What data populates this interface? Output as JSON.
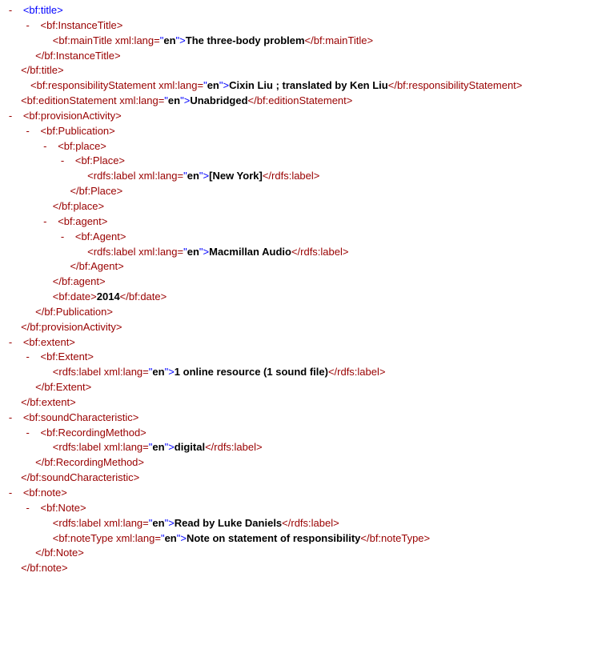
{
  "lang": "en",
  "toggle": "-",
  "tags": {
    "bf_title_open": "<bf:title>",
    "bf_title_close": "</bf:title>",
    "bf_InstanceTitle_open": "<bf:InstanceTitle>",
    "bf_InstanceTitle_close": "</bf:InstanceTitle>",
    "bf_mainTitle_open": "<bf:mainTitle",
    "bf_mainTitle_close": "</bf:mainTitle>",
    "bf_responsibility_open": "<bf:responsibilityStatement",
    "bf_responsibility_close": "</bf:responsibilityStatement>",
    "bf_edition_open": "<bf:editionStatement",
    "bf_edition_close": "</bf:editionStatement>",
    "bf_provisionActivity_open": "<bf:provisionActivity>",
    "bf_provisionActivity_close": "</bf:provisionActivity>",
    "bf_Publication_open": "<bf:Publication>",
    "bf_Publication_close": "</bf:Publication>",
    "bf_place_open": "<bf:place>",
    "bf_place_close": "</bf:place>",
    "bf_Place_open": "<bf:Place>",
    "bf_Place_close": "</bf:Place>",
    "rdfs_label_open": "<rdfs:label",
    "rdfs_label_close": "</rdfs:label>",
    "bf_agent_open": "<bf:agent>",
    "bf_agent_close": "</bf:agent>",
    "bf_Agent_open": "<bf:Agent>",
    "bf_Agent_close": "</bf:Agent>",
    "bf_date_open": "<bf:date>",
    "bf_date_close": "</bf:date>",
    "bf_extent_open": "<bf:extent>",
    "bf_extent_close": "</bf:extent>",
    "bf_Extent_open": "<bf:Extent>",
    "bf_Extent_close": "</bf:Extent>",
    "bf_soundCharacteristic_open": "<bf:soundCharacteristic>",
    "bf_soundCharacteristic_close": "</bf:soundCharacteristic>",
    "bf_RecordingMethod_open": "<bf:RecordingMethod>",
    "bf_RecordingMethod_close": "</bf:RecordingMethod>",
    "bf_note_open": "<bf:note>",
    "bf_note_close": "</bf:note>",
    "bf_Note_open": "<bf:Note>",
    "bf_Note_close": "</bf:Note>",
    "bf_noteType_open": "<bf:noteType",
    "bf_noteType_close": "</bf:noteType>",
    "xml_lang_attr": " xml:lang=",
    "gt": ">",
    "quote": "\""
  },
  "values": {
    "mainTitle": "The three-body problem",
    "responsibility": "Cixin Liu ; translated by Ken Liu",
    "edition": "Unabridged",
    "place_label": "[New York]",
    "agent_label": "Macmillan Audio",
    "date": "2014",
    "extent_label": "1 online resource (1 sound file)",
    "recording_label": "digital",
    "note_label": "Read by Luke Daniels",
    "noteType": "Note on statement of responsibility"
  }
}
